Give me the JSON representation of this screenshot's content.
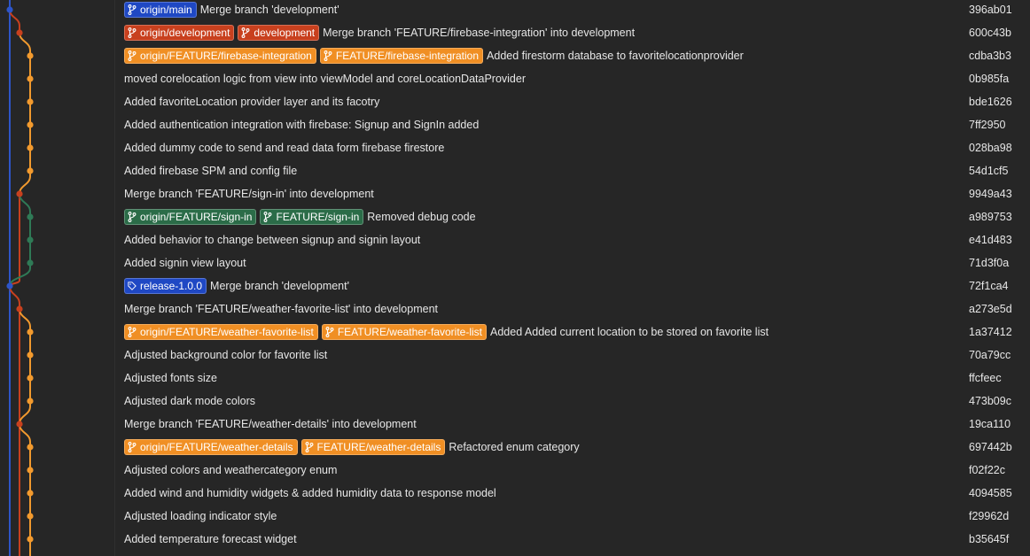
{
  "colors": {
    "main": "#2d55c9",
    "development": "#c8401e",
    "feature": "#f29a2e",
    "signin": "#2f7a56"
  },
  "commits": [
    {
      "message": "Merge branch 'development'",
      "hash": "396ab01",
      "refs": [
        {
          "label": "origin/main",
          "color": "blue",
          "icon": "branch-icon"
        }
      ]
    },
    {
      "message": "Merge branch 'FEATURE/firebase-integration' into development",
      "hash": "600c43b",
      "refs": [
        {
          "label": "origin/development",
          "color": "red",
          "icon": "branch-icon"
        },
        {
          "label": "development",
          "color": "red",
          "icon": "branch-icon"
        }
      ]
    },
    {
      "message": "Added firestorm database to favoritelocationprovider",
      "hash": "cdba3b3",
      "refs": [
        {
          "label": "origin/FEATURE/firebase-integration",
          "color": "orange",
          "icon": "branch-icon"
        },
        {
          "label": "FEATURE/firebase-integration",
          "color": "orange",
          "icon": "branch-icon"
        }
      ]
    },
    {
      "message": "moved corelocation logic from view into viewModel and coreLocationDataProvider",
      "hash": "0b985fa",
      "refs": []
    },
    {
      "message": "Added favoriteLocation provider layer and its facotry",
      "hash": "bde1626",
      "refs": []
    },
    {
      "message": "Added authentication integration with firebase: Signup and SignIn added",
      "hash": "7ff2950",
      "refs": []
    },
    {
      "message": "Added dummy code to send and read data form firebase firestore",
      "hash": "028ba98",
      "refs": []
    },
    {
      "message": "Added firebase SPM and config file",
      "hash": "54d1cf5",
      "refs": []
    },
    {
      "message": "Merge branch 'FEATURE/sign-in' into development",
      "hash": "9949a43",
      "refs": []
    },
    {
      "message": "Removed debug code",
      "hash": "a989753",
      "refs": [
        {
          "label": "origin/FEATURE/sign-in",
          "color": "green",
          "icon": "branch-icon"
        },
        {
          "label": "FEATURE/sign-in",
          "color": "green",
          "icon": "branch-icon"
        }
      ]
    },
    {
      "message": "Added behavior to change between signup and signin layout",
      "hash": "e41d483",
      "refs": []
    },
    {
      "message": "Added signin view layout",
      "hash": "71d3f0a",
      "refs": []
    },
    {
      "message": "Merge branch 'development'",
      "hash": "72f1ca4",
      "refs": [
        {
          "label": "release-1.0.0",
          "color": "blue",
          "icon": "tag-icon"
        }
      ]
    },
    {
      "message": "Merge branch 'FEATURE/weather-favorite-list' into development",
      "hash": "a273e5d",
      "refs": []
    },
    {
      "message": "Added Added current location to be stored on favorite list",
      "hash": "1a37412",
      "refs": [
        {
          "label": "origin/FEATURE/weather-favorite-list",
          "color": "orange",
          "icon": "branch-icon"
        },
        {
          "label": "FEATURE/weather-favorite-list",
          "color": "orange",
          "icon": "branch-icon"
        }
      ]
    },
    {
      "message": "Adjusted background color for favorite list",
      "hash": "70a79cc",
      "refs": []
    },
    {
      "message": "Adjusted fonts size",
      "hash": "ffcfeec",
      "refs": []
    },
    {
      "message": "Adjusted dark mode colors",
      "hash": "473b09c",
      "refs": []
    },
    {
      "message": "Merge branch 'FEATURE/weather-details' into development",
      "hash": "19ca110",
      "refs": []
    },
    {
      "message": "Refactored enum category",
      "hash": "697442b",
      "refs": [
        {
          "label": "origin/FEATURE/weather-details",
          "color": "orange",
          "icon": "branch-icon"
        },
        {
          "label": "FEATURE/weather-details",
          "color": "orange",
          "icon": "branch-icon"
        }
      ]
    },
    {
      "message": "Adjusted colors and weathercategory enum",
      "hash": "f02f22c",
      "refs": []
    },
    {
      "message": "Added wind and humidity widgets & added humidity data to response model",
      "hash": "4094585",
      "refs": []
    },
    {
      "message": "Adjusted loading indicator style",
      "hash": "f29962d",
      "refs": []
    },
    {
      "message": "Added temperature forecast widget",
      "hash": "b35645f",
      "refs": []
    }
  ]
}
